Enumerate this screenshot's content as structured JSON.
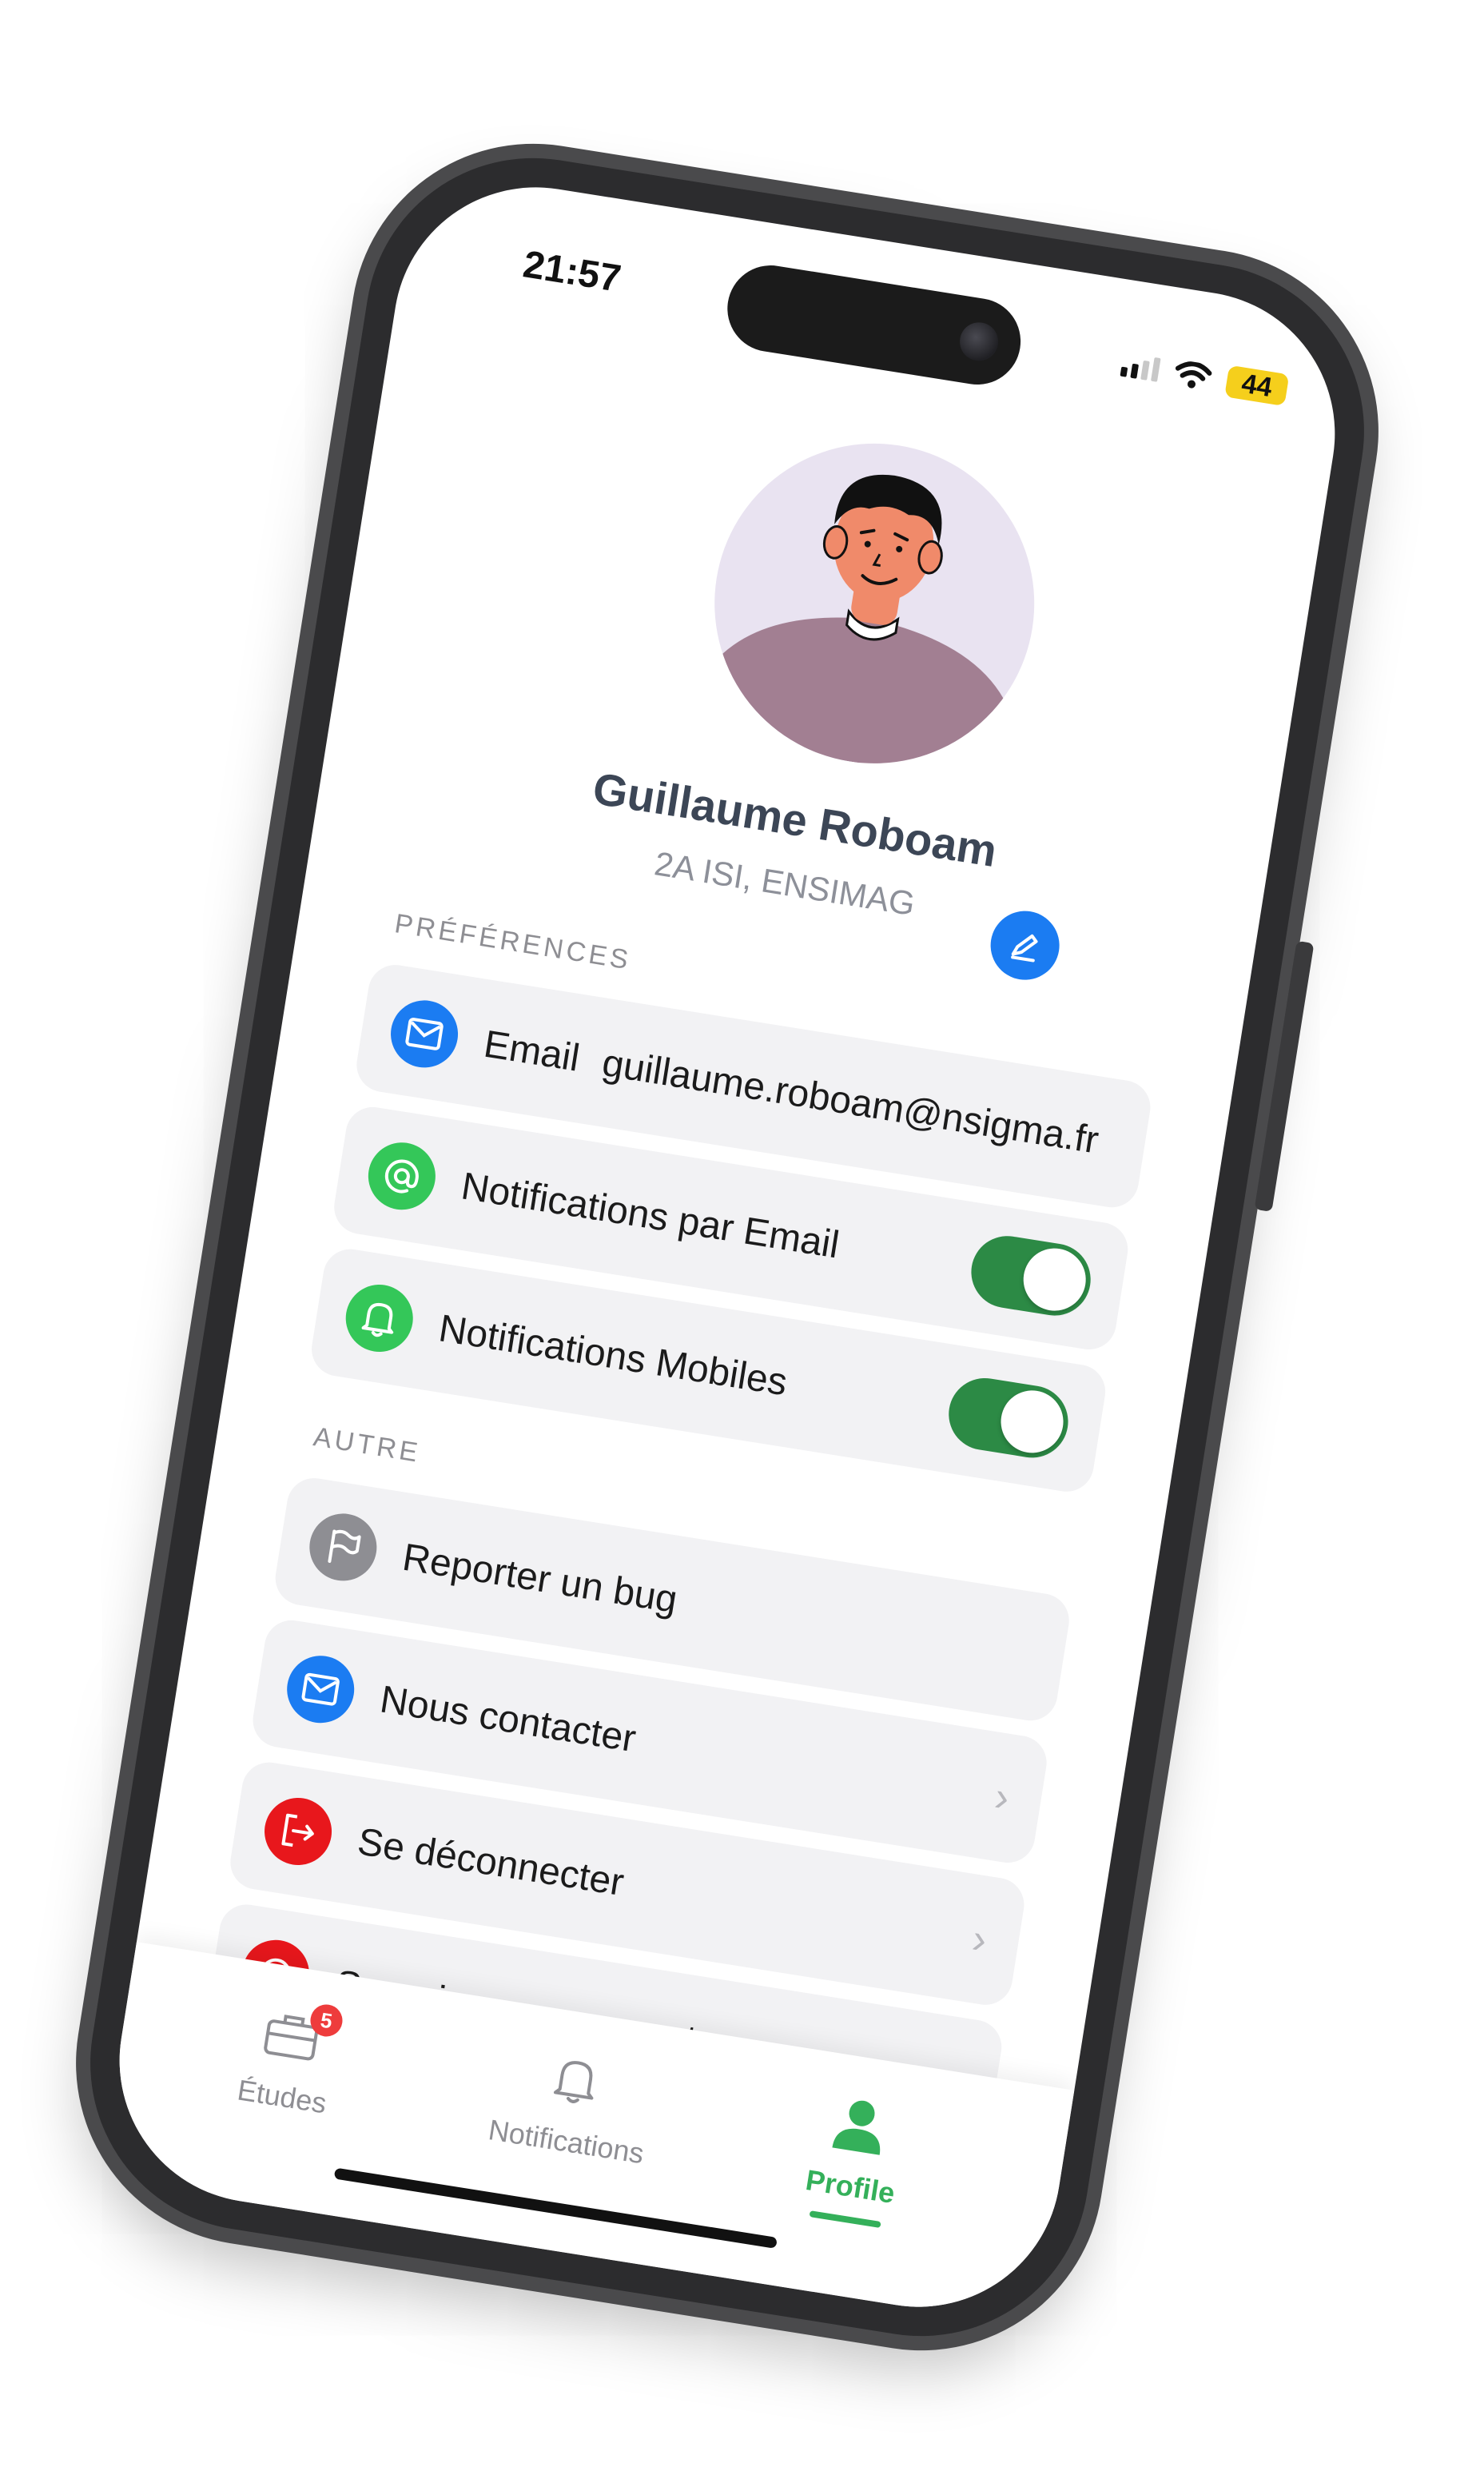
{
  "status_bar": {
    "time": "21:57",
    "battery": "44"
  },
  "profile": {
    "name": "Guillaume Roboam",
    "subtitle": "2A ISI, ENSIMAG"
  },
  "preferences": {
    "title": "PRÉFÉRENCES",
    "email_label": "Email",
    "email_value": "guillaume.roboam@nsigma.fr",
    "notif_email_label": "Notifications par Email",
    "notif_email_on": true,
    "notif_mobile_label": "Notifications Mobiles",
    "notif_mobile_on": true
  },
  "other": {
    "title": "AUTRE",
    "items": [
      {
        "label": "Reporter un bug",
        "icon": "flag-icon",
        "color": "#8e8e93"
      },
      {
        "label": "Nous contacter",
        "icon": "mail-icon",
        "color": "#1b7cf2"
      },
      {
        "label": "Se déconnecter",
        "icon": "logout-icon",
        "color": "#e8171c"
      },
      {
        "label": "Supprimer son compte",
        "icon": "delete-icon",
        "color": "#e8171c"
      }
    ]
  },
  "tabbar": {
    "tabs": [
      {
        "label": "Études",
        "icon": "briefcase-icon",
        "badge": "5"
      },
      {
        "label": "Notifications",
        "icon": "bell-icon"
      },
      {
        "label": "Profile",
        "icon": "person-icon",
        "active": true
      }
    ]
  },
  "colors": {
    "accent_blue": "#1b7cf2",
    "accent_green": "#34b05a",
    "toggle_on": "#2c8a45",
    "danger_red": "#e8171c"
  }
}
